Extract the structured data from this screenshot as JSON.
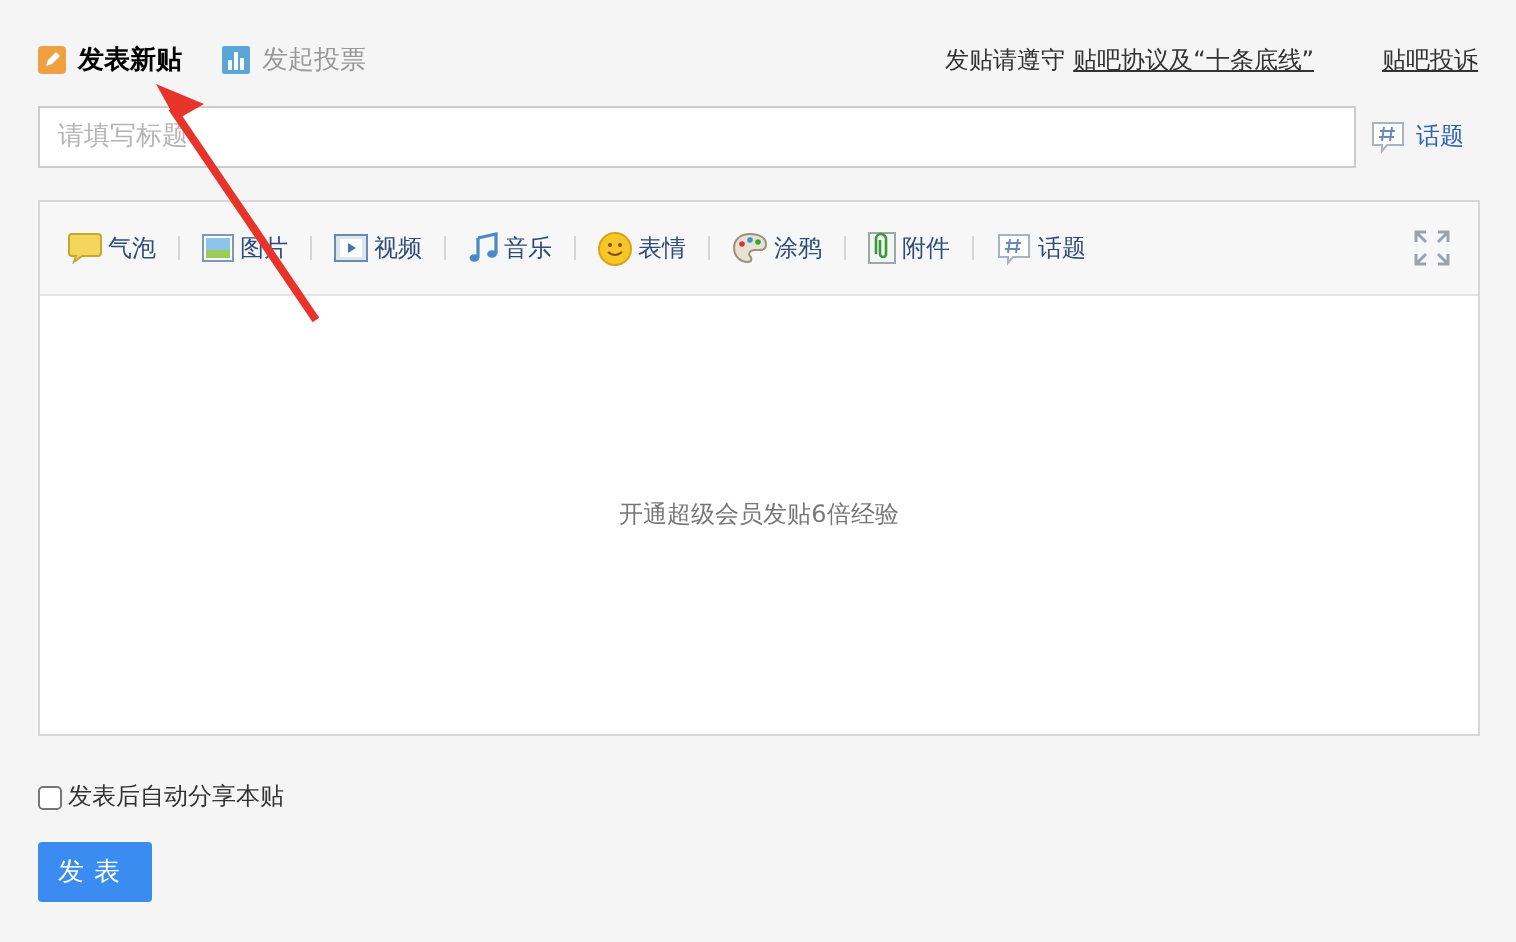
{
  "tabs": [
    {
      "label": "发表新贴",
      "kind": "post",
      "selected": true
    },
    {
      "label": "发起投票",
      "kind": "vote",
      "selected": false
    }
  ],
  "rules": {
    "text": "发贴请遵守",
    "link": "贴吧协议及“十条底线”",
    "report": "贴吧投诉"
  },
  "title_field": {
    "placeholder": "请填写标题",
    "topic": "话题"
  },
  "toolbar": [
    {
      "label": "气泡",
      "kind": "bubble"
    },
    {
      "label": "图片",
      "kind": "image"
    },
    {
      "label": "视频",
      "kind": "video"
    },
    {
      "label": "音乐",
      "kind": "music"
    },
    {
      "label": "表情",
      "kind": "smiley"
    },
    {
      "label": "涂鸦",
      "kind": "palette"
    },
    {
      "label": "附件",
      "kind": "clip"
    },
    {
      "label": "话题",
      "kind": "topic"
    }
  ],
  "editor": {
    "hint": "开通超级会员发贴6倍经验"
  },
  "share": {
    "label": "发表后自动分享本贴",
    "checked": false
  },
  "submit": "发表"
}
